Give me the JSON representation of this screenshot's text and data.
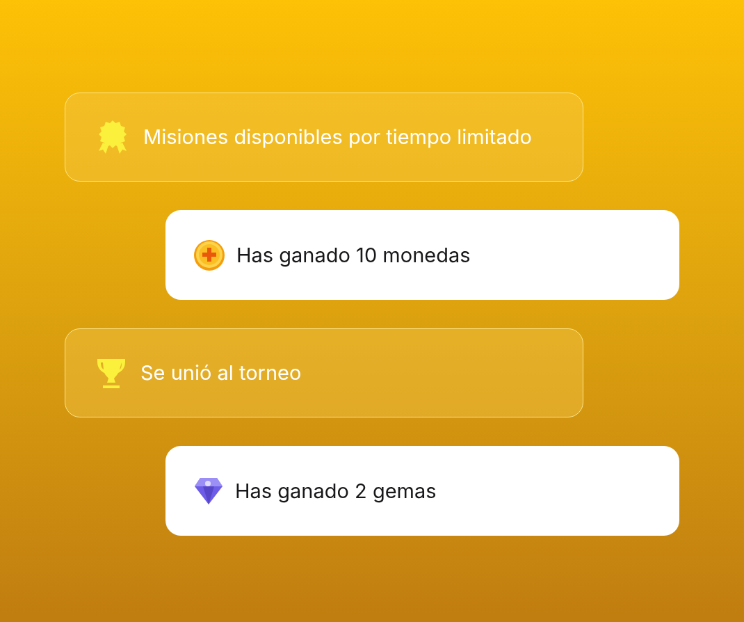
{
  "notifications": [
    {
      "kind": "glass",
      "text": "Misiones disponibles por tiempo limitado"
    },
    {
      "kind": "white",
      "text": "Has ganado 10 monedas"
    },
    {
      "kind": "glass",
      "text": "Se unió al torneo"
    },
    {
      "kind": "white",
      "text": "Has ganado 2 gemas"
    }
  ]
}
